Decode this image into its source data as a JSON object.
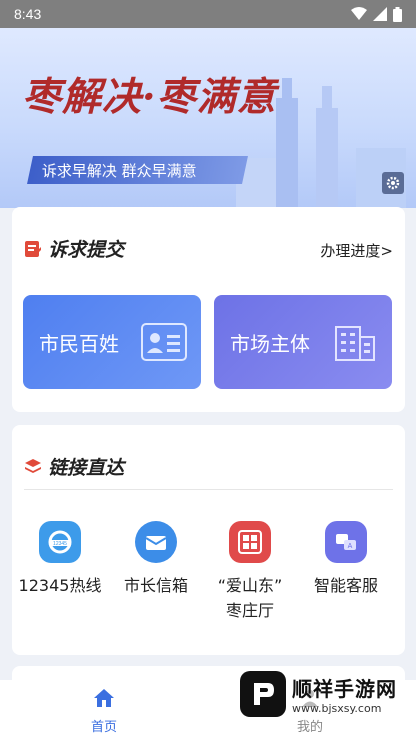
{
  "status_bar": {
    "time": "8:43"
  },
  "banner": {
    "slogan": "枣解决·枣满意",
    "subslogan": "诉求早解决 群众早满意"
  },
  "appeal_card": {
    "title": "诉求提交",
    "progress_link": "办理进度>",
    "entries": [
      {
        "label": "市民百姓"
      },
      {
        "label": "市场主体"
      }
    ]
  },
  "links_card": {
    "title": "链接直达",
    "items": [
      {
        "label": "12345热线",
        "icon": "hotline-icon",
        "color": "#3d9bea"
      },
      {
        "label": "市长信箱",
        "icon": "mailbox-icon",
        "color": "#3c8de8"
      },
      {
        "label": "“爱山东”\n枣庄厅",
        "icon": "ishandong-icon",
        "color": "#e04a4a"
      },
      {
        "label": "智能客服",
        "icon": "robot-service-icon",
        "color": "#6e72e8"
      }
    ]
  },
  "bottom_nav": {
    "home": "首页",
    "mine": "我的"
  },
  "watermark": {
    "name": "顺祥手游网",
    "url": "www.bjsxsy.com"
  },
  "colors": {
    "accent": "#3b6fe0",
    "red": "#b02a2a"
  }
}
